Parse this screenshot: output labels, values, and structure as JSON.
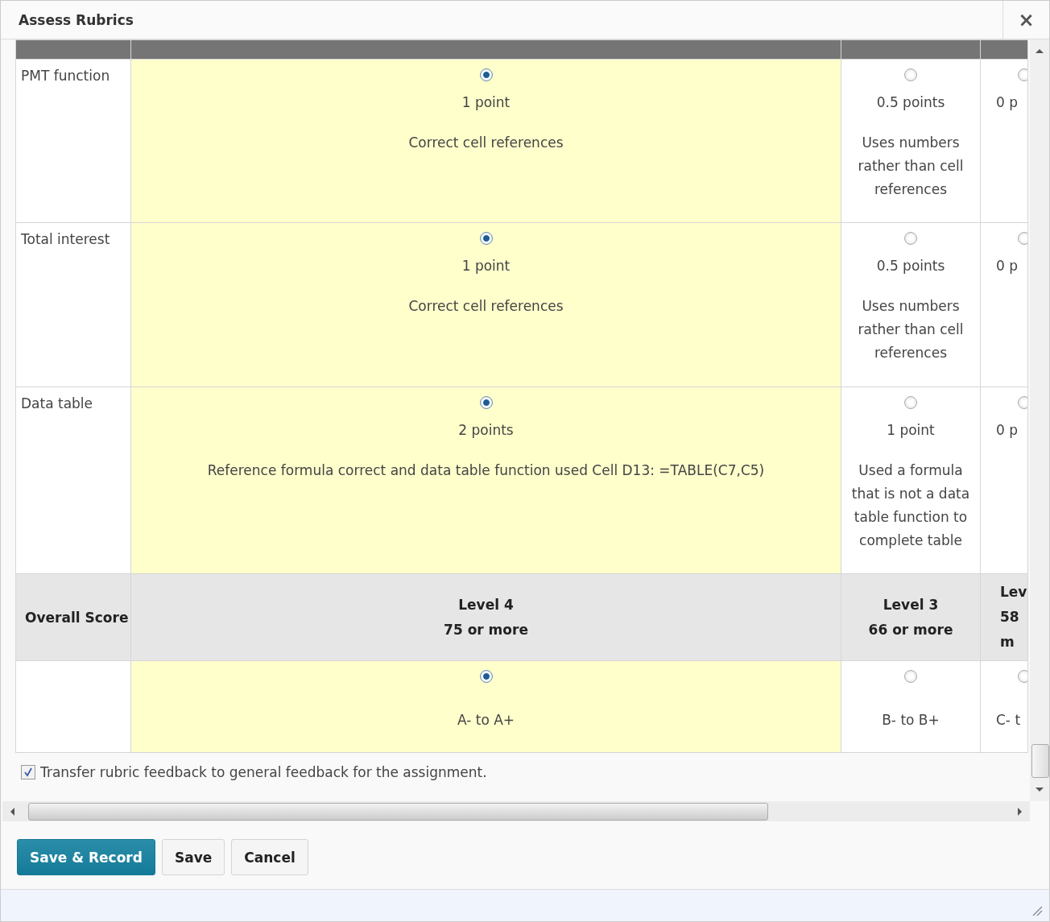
{
  "window": {
    "title": "Assess Rubrics",
    "close": "×"
  },
  "criteria": [
    {
      "name": "PMT function",
      "levels": [
        {
          "points": "1 point",
          "description": "Correct cell references",
          "selected": true
        },
        {
          "points": "0.5 points",
          "description": "Uses numbers rather than cell references",
          "selected": false
        },
        {
          "points": "0 p",
          "selected": false
        }
      ]
    },
    {
      "name": "Total interest",
      "levels": [
        {
          "points": "1 point",
          "description": "Correct cell references",
          "selected": true
        },
        {
          "points": "0.5 points",
          "description": "Uses numbers rather than cell references",
          "selected": false
        },
        {
          "points": "0 p",
          "selected": false
        }
      ]
    },
    {
      "name": "Data table",
      "levels": [
        {
          "points": "2 points",
          "description": "Reference formula correct and data table function used  Cell D13: =TABLE(C7,C5)",
          "selected": true
        },
        {
          "points": "1 point",
          "description": "Used a formula that is not a data table function to complete table",
          "selected": false
        },
        {
          "points": "0 p",
          "selected": false
        }
      ]
    }
  ],
  "overall": {
    "label": "Overall Score",
    "levels": [
      {
        "title": "Level 4",
        "range": "75 or more",
        "grade": "A- to A+",
        "selected": true
      },
      {
        "title": "Level 3",
        "range": "66 or more",
        "grade": "B- to B+",
        "selected": false
      },
      {
        "title": "Lev",
        "range": "58",
        "extra": "m",
        "grade": "C- t",
        "selected": false
      }
    ]
  },
  "transfer": {
    "label": "Transfer rubric feedback to general feedback for the assignment.",
    "checked": true
  },
  "buttons": [
    {
      "label": "Save & Record",
      "kind": "primary"
    },
    {
      "label": "Save",
      "kind": "normal"
    },
    {
      "label": "Cancel",
      "kind": "normal"
    }
  ]
}
